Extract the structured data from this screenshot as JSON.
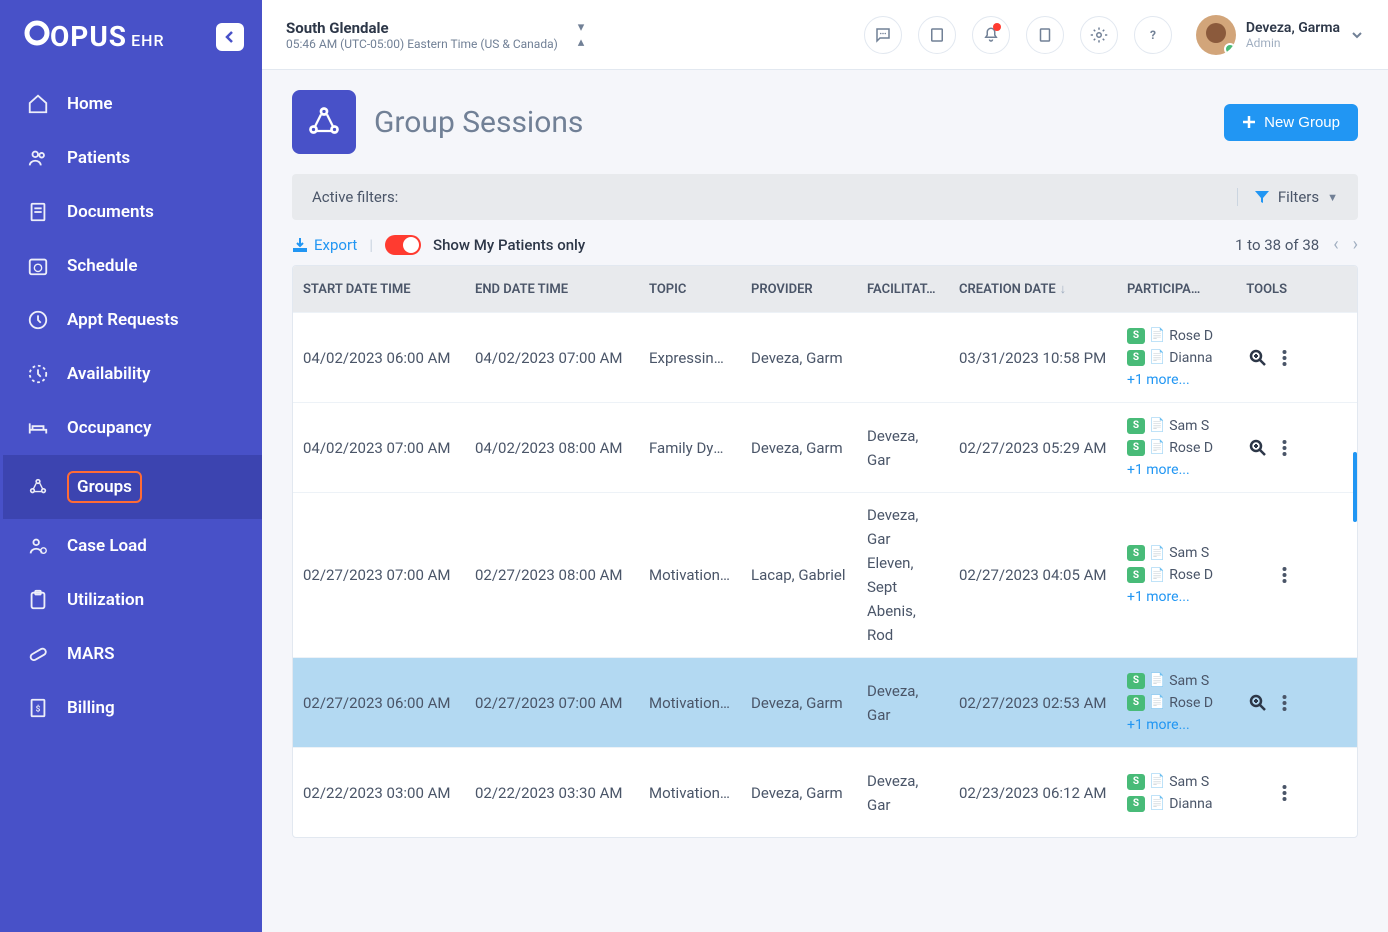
{
  "brand": {
    "name": "OPUS",
    "sub": "EHR"
  },
  "sidebar": {
    "items": [
      {
        "label": "Home"
      },
      {
        "label": "Patients"
      },
      {
        "label": "Documents"
      },
      {
        "label": "Schedule"
      },
      {
        "label": "Appt Requests"
      },
      {
        "label": "Availability"
      },
      {
        "label": "Occupancy"
      },
      {
        "label": "Groups"
      },
      {
        "label": "Case Load"
      },
      {
        "label": "Utilization"
      },
      {
        "label": "MARS"
      },
      {
        "label": "Billing"
      }
    ]
  },
  "topbar": {
    "location": "South Glendale",
    "time": "05:46 AM (UTC-05:00) Eastern Time (US & Canada)",
    "user_name": "Deveza, Garma",
    "user_role": "Admin"
  },
  "page": {
    "title": "Group Sessions",
    "new_btn": "New Group",
    "active_filters": "Active filters:",
    "filters_btn": "Filters",
    "export": "Export",
    "toggle_label": "Show My Patients only",
    "pagination": "1 to 38 of 38"
  },
  "table": {
    "headers": {
      "start": "START DATE TIME",
      "end": "END DATE TIME",
      "topic": "TOPIC",
      "provider": "PROVIDER",
      "fac": "FACILITAT…",
      "created": "CREATION DATE",
      "part": "PARTICIPA…",
      "tools": "TOOLS"
    },
    "rows": [
      {
        "start": "04/02/2023 06:00 AM",
        "end": "04/02/2023 07:00 AM",
        "topic": "Expressing an",
        "provider": "Deveza, Garm",
        "fac": "",
        "created": "03/31/2023 10:58 PM",
        "p1": "Rose D",
        "p2": "Dianna",
        "more": "+1 more...",
        "doc1": "green",
        "doc2": "green",
        "zoom": true
      },
      {
        "start": "04/02/2023 07:00 AM",
        "end": "04/02/2023 08:00 AM",
        "topic": "Family Dynam",
        "provider": "Deveza, Garm",
        "fac": "Deveza, Gar",
        "created": "02/27/2023 05:29 AM",
        "p1": "Sam S",
        "p2": "Rose D",
        "more": "+1 more...",
        "doc1": "red",
        "doc2": "red",
        "zoom": true
      },
      {
        "start": "02/27/2023 07:00 AM",
        "end": "02/27/2023 08:00 AM",
        "topic": "Motivation wit",
        "provider": "Lacap, Gabriel",
        "fac": "Deveza, Gar Eleven, Sept Abenis, Rod",
        "created": "02/27/2023 04:05 AM",
        "p1": "Sam S",
        "p2": "Rose D",
        "more": "+1 more...",
        "doc1": "red",
        "doc2": "red",
        "zoom": false
      },
      {
        "start": "02/27/2023 06:00 AM",
        "end": "02/27/2023 07:00 AM",
        "topic": "Motivation wit",
        "provider": "Deveza, Garm",
        "fac": "Deveza, Gar",
        "created": "02/27/2023 02:53 AM",
        "p1": "Sam S",
        "p2": "Rose D",
        "more": "+1 more...",
        "doc1": "red",
        "doc2": "red",
        "zoom": true,
        "highlight": true
      },
      {
        "start": "02/22/2023 03:00 AM",
        "end": "02/22/2023 03:30 AM",
        "topic": "Motivation wit",
        "provider": "Deveza, Garm",
        "fac": "Deveza, Gar",
        "created": "02/23/2023 06:12 AM",
        "p1": "Sam S",
        "p2": "Dianna",
        "more": "",
        "doc1": "red",
        "doc2": "red",
        "zoom": false
      }
    ]
  }
}
